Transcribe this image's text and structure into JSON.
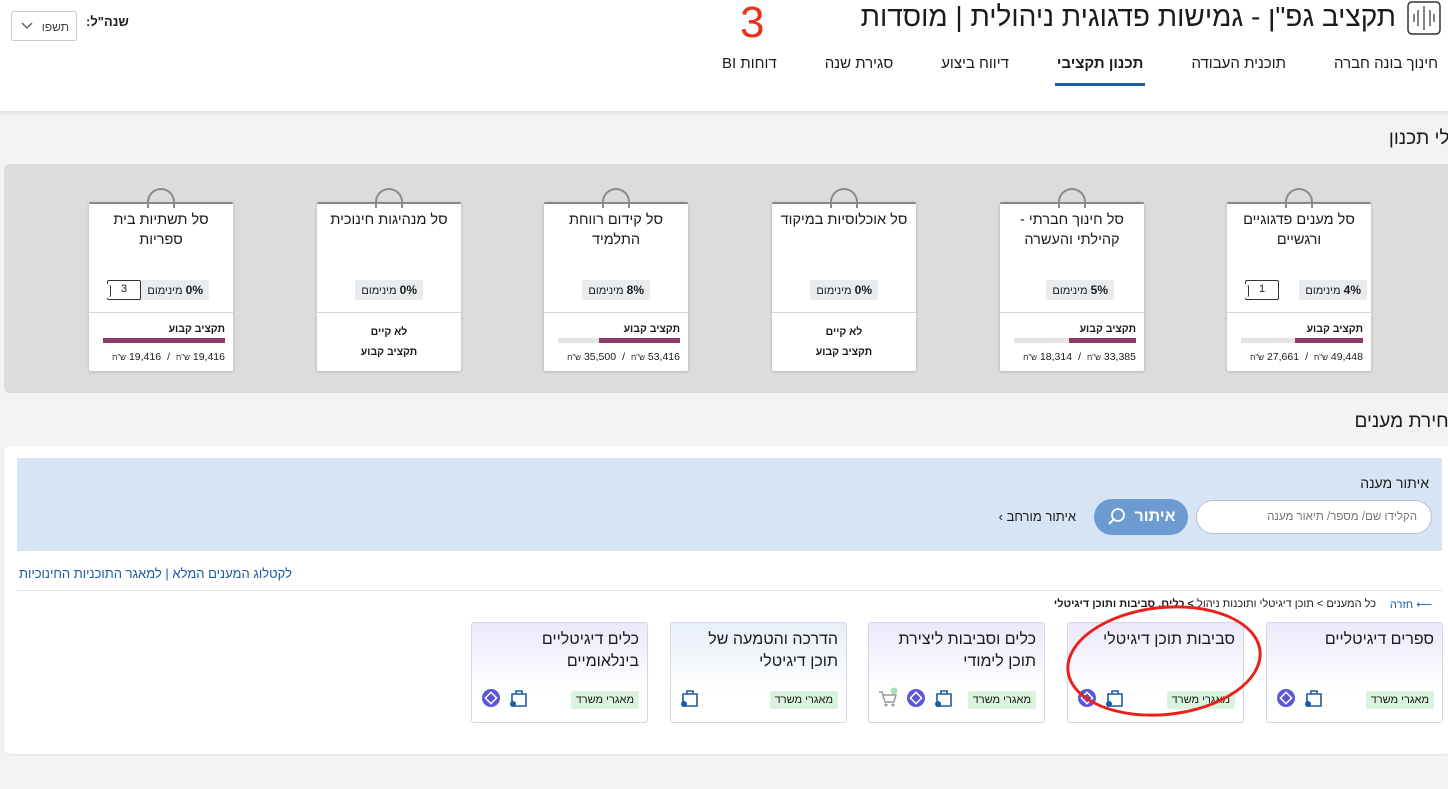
{
  "header": {
    "title": "תקציב גפ\"ן - גמישות פדגוגית ניהולית | מוסדות",
    "annotation_number": "3",
    "year_label": "שנה\"ל:",
    "year_value": "תשפו"
  },
  "nav": {
    "items": [
      {
        "label": "חינוך בונה חברה"
      },
      {
        "label": "תוכנית העבודה"
      },
      {
        "label": "תכנון תקציבי"
      },
      {
        "label": "דיווח ביצוע"
      },
      {
        "label": "סגירת שנה"
      },
      {
        "label": "דוחות BI"
      }
    ]
  },
  "baskets_section": {
    "title": "סלי תכנון",
    "fixed_budget_label": "תקציב קבוע",
    "no_fixed_label": "לא קיים",
    "currency": "ש\"ח",
    "baskets": [
      {
        "name": "סל מענים פדגוגיים ורגשיים",
        "min_pct": "4%",
        "min_label": "מינימום",
        "tag": "1",
        "spent": "27,661",
        "total": "49,448",
        "fill": 0.56
      },
      {
        "name": "סל חינוך חברתי - קהילתי והעשרה",
        "min_pct": "5%",
        "min_label": "מינימום",
        "spent": "18,314",
        "total": "33,385",
        "fill": 0.55
      },
      {
        "name": "סל אוכלוסיות במיקוד",
        "min_pct": "0%",
        "min_label": "מינימום"
      },
      {
        "name": "סל קידום רווחת התלמיד",
        "min_pct": "8%",
        "min_label": "מינימום",
        "spent": "35,500",
        "total": "53,416",
        "fill": 0.66
      },
      {
        "name": "סל מנהיגות חינוכית",
        "min_pct": "0%",
        "min_label": "מינימום"
      },
      {
        "name": "סל תשתיות בית ספריות",
        "min_pct": "0%",
        "min_label": "מינימום",
        "tag": "3",
        "spent": "19,416",
        "total": "19,416",
        "fill": 1.0
      }
    ]
  },
  "selection_section": {
    "title": "בחירת מענים",
    "search_title": "איתור מענה",
    "search_placeholder": "הקלידו שם/ מספר/ תיאור מענה",
    "search_button": "איתור",
    "advanced_search": "איתור מורחב",
    "catalog_link": "לקטלוג המענים המלא",
    "separator": "|",
    "programs_link": "למאגר התוכניות החינוכיות",
    "back_label": "חזרה",
    "crumb_1": "כל המענים",
    "crumb_2": "תוכן דיגיטלי ותוכנות ניהול",
    "crumb_current": "כלים, סביבות ותוכן דיגיטלי",
    "cards": [
      {
        "title": "ספרים דיגיטליים",
        "badge": "מאגרי משרד"
      },
      {
        "title": "סביבות תוכן דיגיטלי",
        "badge": "מאגרי משרד"
      },
      {
        "title": "כלים וסביבות ליצירת תוכן לימודי",
        "badge": "מאגרי משרד"
      },
      {
        "title": "הדרכה והטמעה של תוכן דיגיטלי",
        "badge": "מאגרי משרד"
      },
      {
        "title": "כלים דיגיטליים בינלאומיים",
        "badge": "מאגרי משרד"
      }
    ]
  },
  "colors": {
    "accent": "#1a5ba8",
    "progress_fill": "#8c3a67",
    "badge_green": "#d9f3dc",
    "annotation_red": "#e8211c"
  }
}
